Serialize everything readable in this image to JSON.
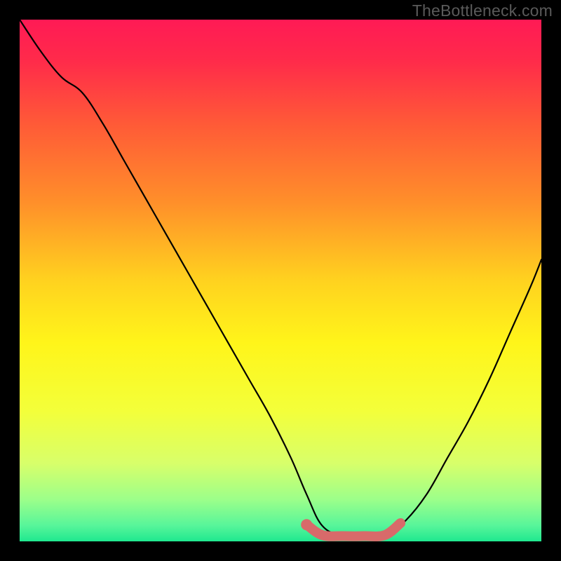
{
  "watermark": "TheBottleneck.com",
  "colors": {
    "background": "#000000",
    "gradient_stops": [
      {
        "offset": 0.0,
        "color": "#ff1a55"
      },
      {
        "offset": 0.08,
        "color": "#ff2b4a"
      },
      {
        "offset": 0.2,
        "color": "#ff5a37"
      },
      {
        "offset": 0.35,
        "color": "#ff8f2a"
      },
      {
        "offset": 0.5,
        "color": "#ffd21f"
      },
      {
        "offset": 0.62,
        "color": "#fff51a"
      },
      {
        "offset": 0.75,
        "color": "#f3ff3a"
      },
      {
        "offset": 0.85,
        "color": "#d8ff6a"
      },
      {
        "offset": 0.92,
        "color": "#9cff8a"
      },
      {
        "offset": 0.97,
        "color": "#57f59a"
      },
      {
        "offset": 1.0,
        "color": "#1fe88f"
      }
    ],
    "curve": "#000000",
    "highlight": "#d86a6a"
  },
  "chart_data": {
    "type": "line",
    "title": "",
    "xlabel": "",
    "ylabel": "",
    "xlim": [
      0,
      100
    ],
    "ylim": [
      0,
      100
    ],
    "grid": false,
    "series": [
      {
        "name": "bottleneck-curve",
        "x": [
          0,
          4,
          8,
          12,
          16,
          20,
          24,
          28,
          32,
          36,
          40,
          44,
          48,
          52,
          55,
          58,
          62,
          66,
          70,
          74,
          78,
          82,
          86,
          90,
          94,
          98,
          100
        ],
        "y": [
          100,
          94,
          89,
          86,
          80,
          73,
          66,
          59,
          52,
          45,
          38,
          31,
          24,
          16,
          9,
          3,
          1,
          1,
          1,
          4,
          9,
          16,
          23,
          31,
          40,
          49,
          54
        ]
      }
    ],
    "highlight_segment": {
      "name": "optimal-range",
      "x": [
        55,
        58,
        62,
        66,
        70,
        73
      ],
      "y": [
        3.2,
        1.2,
        1.0,
        1.0,
        1.2,
        3.5
      ]
    },
    "highlight_point": {
      "x": 55,
      "y": 3.2
    },
    "annotations": []
  }
}
